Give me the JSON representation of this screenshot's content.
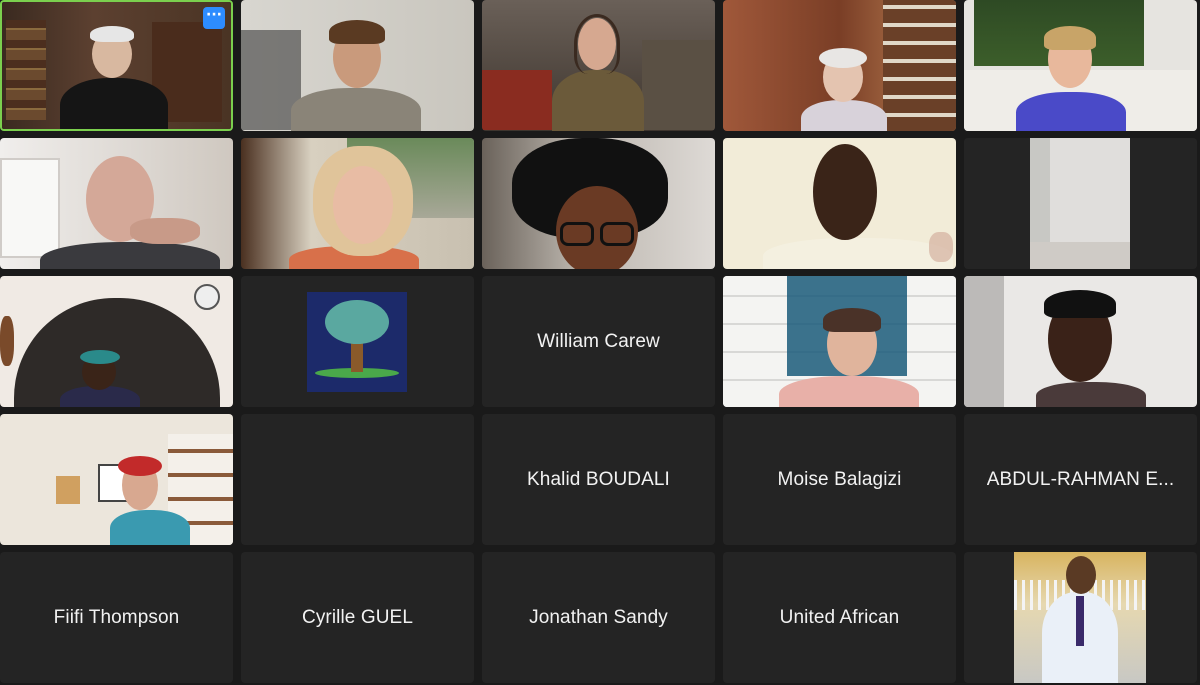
{
  "participants": [
    {
      "id": "p1",
      "type": "video",
      "scene": "library-elderly-man",
      "active": true,
      "more_icon": "more-options-icon",
      "more_label": "···"
    },
    {
      "id": "p2",
      "type": "video",
      "scene": "young-man-glasses"
    },
    {
      "id": "p3",
      "type": "video",
      "scene": "woman-headphones-room"
    },
    {
      "id": "p4",
      "type": "video",
      "scene": "elderly-woman-wood-room"
    },
    {
      "id": "p5",
      "type": "video",
      "scene": "woman-blue-shirt-plants"
    },
    {
      "id": "p6",
      "type": "video",
      "scene": "bald-man-thinking"
    },
    {
      "id": "p7",
      "type": "video",
      "scene": "woman-curly-blonde-hair"
    },
    {
      "id": "p8",
      "type": "video",
      "scene": "woman-glasses-curly-hair"
    },
    {
      "id": "p9",
      "type": "video",
      "scene": "man-looking-down"
    },
    {
      "id": "p10",
      "type": "video",
      "scene": "empty-room-window"
    },
    {
      "id": "p11",
      "type": "video",
      "scene": "woman-arched-room"
    },
    {
      "id": "p12",
      "type": "image",
      "scene": "tree-avatar"
    },
    {
      "id": "p13",
      "type": "name",
      "name": "William Carew"
    },
    {
      "id": "p14",
      "type": "video",
      "scene": "woman-bookshelf"
    },
    {
      "id": "p15",
      "type": "video",
      "scene": "woman-braided-hair"
    },
    {
      "id": "p16",
      "type": "video",
      "scene": "woman-red-hair-room"
    },
    {
      "id": "p17",
      "type": "blank"
    },
    {
      "id": "p18",
      "type": "name",
      "name": "Khalid BOUDALI"
    },
    {
      "id": "p19",
      "type": "name",
      "name": "Moise Balagizi"
    },
    {
      "id": "p20",
      "type": "name",
      "name": "ABDUL-RAHMAN E..."
    },
    {
      "id": "p21",
      "type": "name",
      "name": "Fiifi Thompson"
    },
    {
      "id": "p22",
      "type": "name",
      "name": "Cyrille GUEL"
    },
    {
      "id": "p23",
      "type": "name",
      "name": "Jonathan Sandy"
    },
    {
      "id": "p24",
      "type": "name",
      "name": "United African"
    },
    {
      "id": "p25",
      "type": "image",
      "scene": "man-suit-photo"
    }
  ]
}
